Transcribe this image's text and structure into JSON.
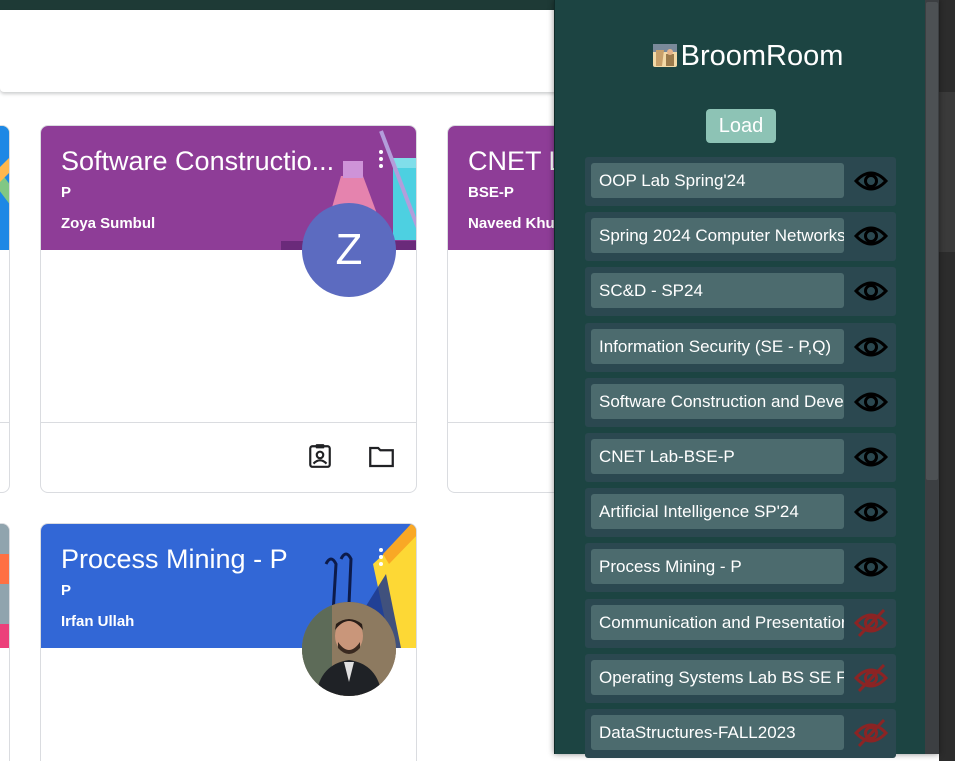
{
  "panel": {
    "title": "BroomRoom",
    "load_label": "Load",
    "colors": {
      "background": "#1c4442",
      "row": "#2b4850",
      "label": "#4c6b6e",
      "load": "#8dc3b5",
      "hidden_eye": "#8b2424"
    },
    "classes": [
      {
        "name": "OOP Lab Spring'24",
        "visible": true
      },
      {
        "name": "Spring 2024 Computer Networks",
        "visible": true
      },
      {
        "name": "SC&D - SP24",
        "visible": true
      },
      {
        "name": "Information Security (SE - P,Q)",
        "visible": true
      },
      {
        "name": "Software Construction and Development",
        "visible": true
      },
      {
        "name": "CNET Lab-BSE-P",
        "visible": true
      },
      {
        "name": "Artificial Intelligence SP'24",
        "visible": true
      },
      {
        "name": "Process Mining - P",
        "visible": true
      },
      {
        "name": "Communication and Presentation Skills",
        "visible": false
      },
      {
        "name": "Operating Systems Lab BS SE F",
        "visible": false
      },
      {
        "name": "DataStructures-FALL2023",
        "visible": false
      }
    ]
  },
  "cards": [
    {
      "title": "Software Constructio...",
      "section": "P",
      "teacher": "Zoya Sumbul",
      "avatar_letter": "Z",
      "color": "#8e3d97"
    },
    {
      "title": "CNET L",
      "section": "BSE-P",
      "teacher": "Naveed Khu",
      "color": "#8e3d97"
    },
    {
      "title": "Process Mining - P",
      "section": "P",
      "teacher": "Irfan Ullah",
      "color": "#3267d6"
    }
  ]
}
